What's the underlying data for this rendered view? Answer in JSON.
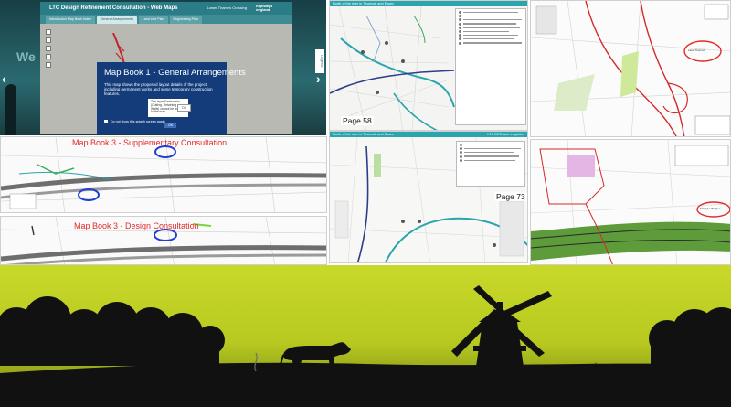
{
  "webmap": {
    "background_text": "We",
    "app_title": "LTC Design Refinement Consultation - Web Maps",
    "user_label": "Lower Thames Crossing",
    "logo_text": "highways england",
    "tabs": [
      "Introduction Map Book Index",
      "General Arrangements",
      "Land Use Plan",
      "Engineering Plan"
    ],
    "active_tab": 1,
    "side_tab": "Legend",
    "modal": {
      "title": "Map Book 1 - General Arrangements",
      "body": "This map shows the proposed layout details of the project including permanent works and some temporary construction features.",
      "notice": "The layer Earthworks (Cutting, Retaining Walls) cannot be added to the map.",
      "ok_small": "OK",
      "checkbox_label": "Do not show this splash screen again",
      "ok_button": "OK"
    }
  },
  "sheets": {
    "page58": {
      "header": "North of the river in Thurrock and Essex",
      "page_label": "Page 58"
    },
    "page73": {
      "header": "North of the river in Thurrock and Essex",
      "header_right": "LTC DRC web enquiries",
      "page_label": "Page 73"
    },
    "topright": {
      "callout": "Lake Thurrock"
    },
    "bottomright": {
      "callout": "Mardyke Bridges"
    },
    "supplementary": {
      "title": "Map Book 3 - Supplementary Consultation"
    },
    "design": {
      "title": "Map Book 3 - Design Consultation"
    }
  },
  "colors": {
    "teal_header": "#2a7c86",
    "modal_blue": "#143c7a",
    "sky_yellow": "#c9d92a",
    "silhouette": "#111111",
    "callout_red": "#e32a2a",
    "callout_blue": "#1f3fd0"
  }
}
